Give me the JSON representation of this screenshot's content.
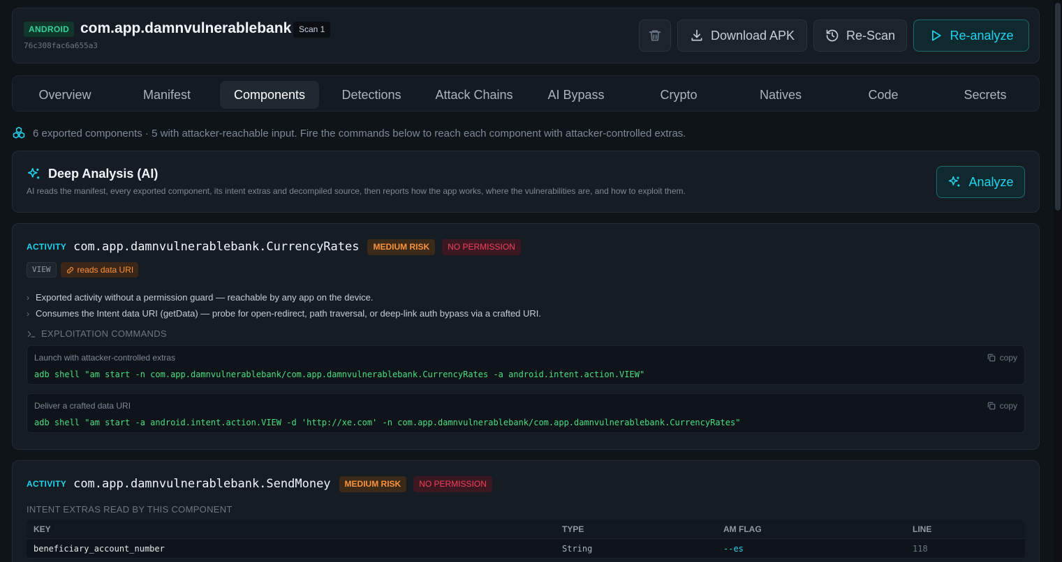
{
  "header": {
    "platform": "ANDROID",
    "package_name": "com.app.damnvulnerablebank",
    "scan_label": "Scan 1",
    "hash": "76c308fac6a655a3",
    "download_label": "Download APK",
    "rescan_label": "Re-Scan",
    "reanalyze_label": "Re-analyze"
  },
  "tabs": [
    {
      "label": "Overview",
      "active": false
    },
    {
      "label": "Manifest",
      "active": false
    },
    {
      "label": "Components",
      "active": true
    },
    {
      "label": "Detections",
      "active": false
    },
    {
      "label": "Attack Chains",
      "active": false
    },
    {
      "label": "AI Bypass",
      "active": false
    },
    {
      "label": "Crypto",
      "active": false
    },
    {
      "label": "Natives",
      "active": false
    },
    {
      "label": "Code",
      "active": false
    },
    {
      "label": "Secrets",
      "active": false
    }
  ],
  "summary": "6 exported components · 5 with attacker-reachable input. Fire the commands below to reach each component with attacker-controlled extras.",
  "deep_analysis": {
    "title": "Deep Analysis (AI)",
    "description": "AI reads the manifest, every exported component, its intent extras and decompiled source, then reports how the app works, where the vulnerabilities are, and how to exploit them.",
    "button_label": "Analyze"
  },
  "components": [
    {
      "kind": "ACTIVITY",
      "name": "com.app.damnvulnerablebank.CurrencyRates",
      "risk": "MEDIUM RISK",
      "permission": "NO PERMISSION",
      "action_tag": "VIEW",
      "uri_tag": "reads data URI",
      "findings": [
        "Exported activity without a permission guard — reachable by any app on the device.",
        "Consumes the Intent data URI (getData) — probe for open-redirect, path traversal, or deep-link auth bypass via a crafted URI."
      ],
      "exploitation_header": "EXPLOITATION COMMANDS",
      "commands": [
        {
          "label": "Launch with attacker-controlled extras",
          "command": "adb shell \"am start -n com.app.damnvulnerablebank/com.app.damnvulnerablebank.CurrencyRates -a android.intent.action.VIEW\"",
          "copy_label": "copy"
        },
        {
          "label": "Deliver a crafted data URI",
          "command": "adb shell \"am start -a android.intent.action.VIEW -d 'http://xe.com' -n com.app.damnvulnerablebank/com.app.damnvulnerablebank.CurrencyRates\"",
          "copy_label": "copy"
        }
      ]
    },
    {
      "kind": "ACTIVITY",
      "name": "com.app.damnvulnerablebank.SendMoney",
      "risk": "MEDIUM RISK",
      "permission": "NO PERMISSION",
      "extras_header": "INTENT EXTRAS READ BY THIS COMPONENT",
      "extras_columns": [
        "KEY",
        "TYPE",
        "AM FLAG",
        "LINE"
      ],
      "extras_rows": [
        {
          "key": "beneficiary_account_number",
          "type": "String",
          "flag": "--es",
          "line": "118"
        }
      ]
    }
  ],
  "colors": {
    "accent": "#22d3ee",
    "android_badge": "#34d399",
    "risk_medium": "#fb923c",
    "no_permission": "#f43f5e",
    "command_text": "#4ade80"
  },
  "icons": {
    "delete": "trash-icon",
    "download": "download-icon",
    "rescan": "history-icon",
    "reanalyze": "play-icon",
    "summary": "components-icon",
    "ai": "sparkles-icon",
    "link": "link-icon",
    "terminal": "terminal-icon",
    "copy": "copy-icon"
  }
}
